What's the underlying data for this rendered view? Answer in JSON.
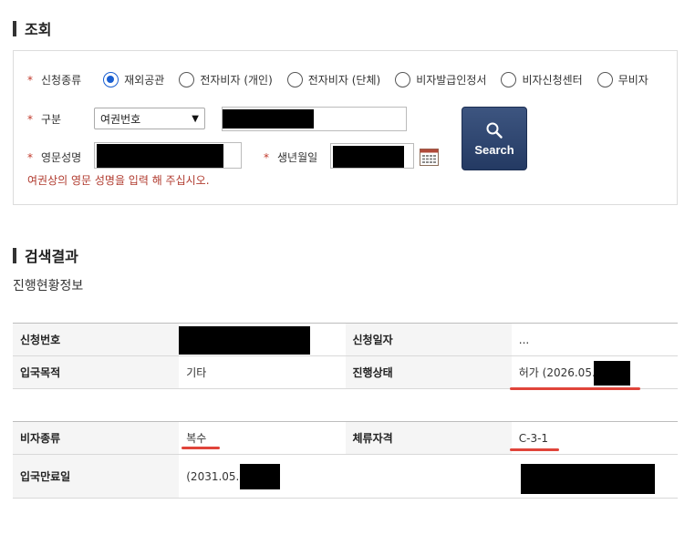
{
  "lookup": {
    "title": "조회",
    "application_type": {
      "label": "신청종류",
      "options": [
        "재외공관",
        "전자비자 (개인)",
        "전자비자 (단체)",
        "비자발급인정서",
        "비자신청센터",
        "무비자"
      ],
      "selected_index": 0
    },
    "category": {
      "label": "구분",
      "selected": "여권번호"
    },
    "english_name": {
      "label": "영문성명"
    },
    "birth_date": {
      "label": "생년월일"
    },
    "required_mark": "*",
    "hint": "여권상의 영문 성명을 입력 해 주십시오.",
    "search_button": "Search"
  },
  "results": {
    "title": "검색결과",
    "subtitle": "진행현황정보",
    "table1": [
      {
        "label1": "신청번호",
        "value1": "",
        "label2": "신청일자",
        "value2": "..."
      },
      {
        "label1": "입국목적",
        "value1": "기타",
        "label2": "진행상태",
        "value2": "허가 (2026.05."
      }
    ],
    "table2": [
      {
        "label1": "비자종류",
        "value1": "복수",
        "label2": "체류자격",
        "value2": "C-3-1"
      },
      {
        "label1": "입국만료일",
        "value1": "(2031.05.",
        "label2": "",
        "value2": ""
      }
    ]
  },
  "colors": {
    "accent_blue": "#1a5fd1",
    "button_navy": "#243a63",
    "hint_red": "#b03a2e",
    "underline_red": "#e0443a"
  }
}
